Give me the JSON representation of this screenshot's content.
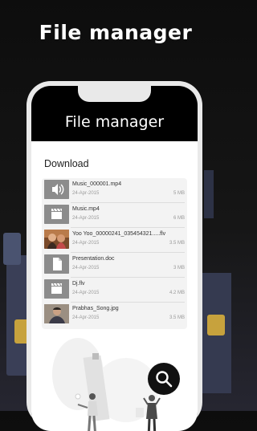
{
  "promo": {
    "title": "File manager"
  },
  "app": {
    "title": "File manager"
  },
  "section": {
    "title": "Download"
  },
  "files": [
    {
      "name": "Music_000001.mp4",
      "date": "24-Apr-2015",
      "size": "5 MB",
      "icon": "volume-icon"
    },
    {
      "name": "Music.mp4",
      "date": "24-Apr-2015",
      "size": "6 MB",
      "icon": "video-icon"
    },
    {
      "name": "Yoo Yoo_00000241_035454321.....flv",
      "date": "24-Apr-2015",
      "size": "3.5 MB",
      "icon": "photo-thumbnail"
    },
    {
      "name": "Presentation.doc",
      "date": "24-Apr-2015",
      "size": "3 MB",
      "icon": "document-icon"
    },
    {
      "name": "Dj.flv",
      "date": "24-Apr-2015",
      "size": "4.2 MB",
      "icon": "video-icon"
    },
    {
      "name": "Prabhas_Song.jpg",
      "date": "24-Apr-2015",
      "size": "3.5 MB",
      "icon": "photo-thumbnail"
    }
  ],
  "colors": {
    "background": "#111111",
    "screen": "#ffffff",
    "accent": "#111111",
    "list_bg": "#f3f3f3"
  }
}
